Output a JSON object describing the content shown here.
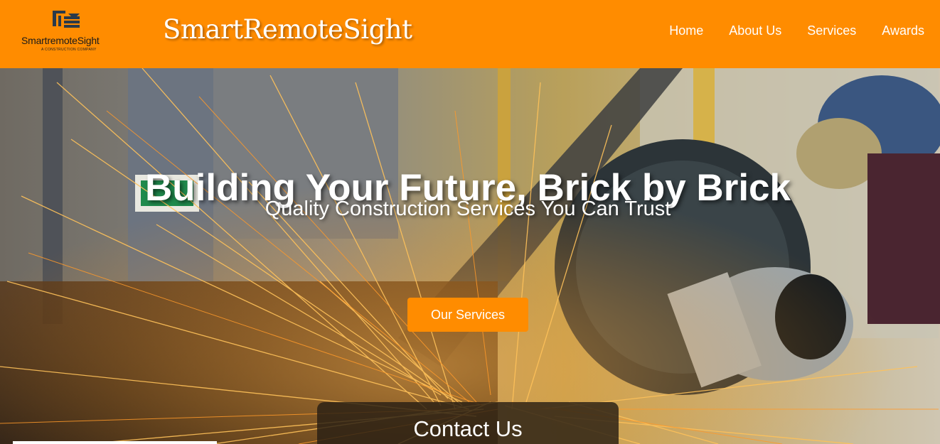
{
  "header": {
    "logo_text": "SmartremoteSight",
    "logo_tagline": "A CONSTRUCTION COMPANY",
    "brand": "SmartRemoteSight",
    "nav": [
      {
        "label": "Home"
      },
      {
        "label": "About Us"
      },
      {
        "label": "Services"
      },
      {
        "label": "Awards"
      }
    ]
  },
  "hero": {
    "title": "Building Your Future, Brick by Brick",
    "subtitle": "Quality Construction Services You Can Trust",
    "cta_label": "Our Services"
  },
  "contact": {
    "title": "Contact Us"
  },
  "colors": {
    "accent": "#ff8c00",
    "text_on_accent": "#ffffff"
  }
}
